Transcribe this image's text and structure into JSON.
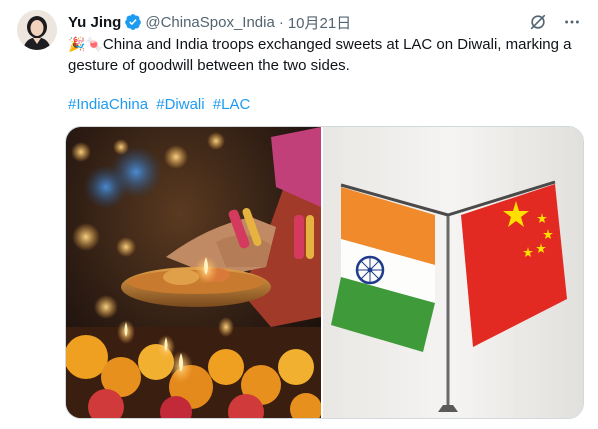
{
  "tweet": {
    "author_name": "Yu Jing",
    "author_handle": "@ChinaSpox_India",
    "separator": "·",
    "date": "10月21日",
    "emoji_1": "🎉",
    "emoji_2": "🍬",
    "text": "China and India troops exchanged sweets at LAC on Diwali, marking a gesture of goodwill between the two sides.",
    "hashtags": [
      "#IndiaChina",
      "#Diwali",
      "#LAC"
    ]
  },
  "icons": {
    "verified": "verified-badge-icon",
    "grok": "grok-icon",
    "more": "more-icon"
  },
  "media": [
    {
      "name": "diwali-lamps-photo"
    },
    {
      "name": "india-china-flags-photo"
    }
  ],
  "colors": {
    "accent": "#1d9bf0",
    "secondary_text": "#536471",
    "primary_text": "#0f1419"
  }
}
